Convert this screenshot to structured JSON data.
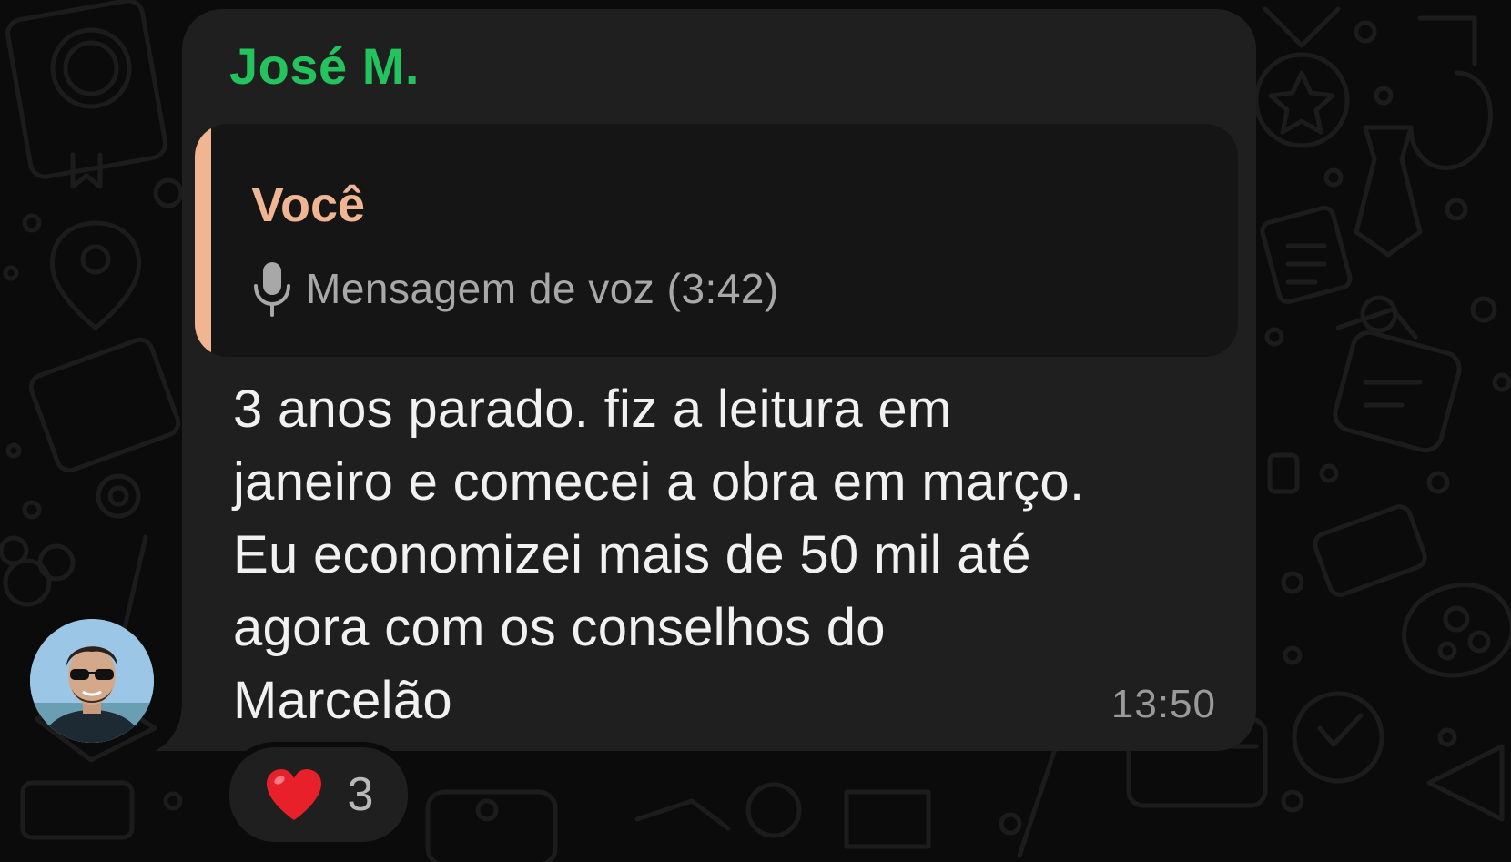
{
  "message": {
    "sender_name": "José M.",
    "quoted": {
      "author": "Você",
      "icon": "microphone-icon",
      "text": "Mensagem de voz (3:42)"
    },
    "body": "3 anos parado. fiz a leitura em\njaneiro e comecei a obra em março.\nEu economizei mais de 50 mil até\nagora com os conselhos do\nMarcelão",
    "time": "13:50"
  },
  "reaction": {
    "emoji": "heart-icon",
    "count": "3"
  },
  "colors": {
    "sender_name": "#23c45e",
    "quote_accent": "#f0b592",
    "bubble": "#1f1f1f",
    "background": "#0b0b0b"
  }
}
